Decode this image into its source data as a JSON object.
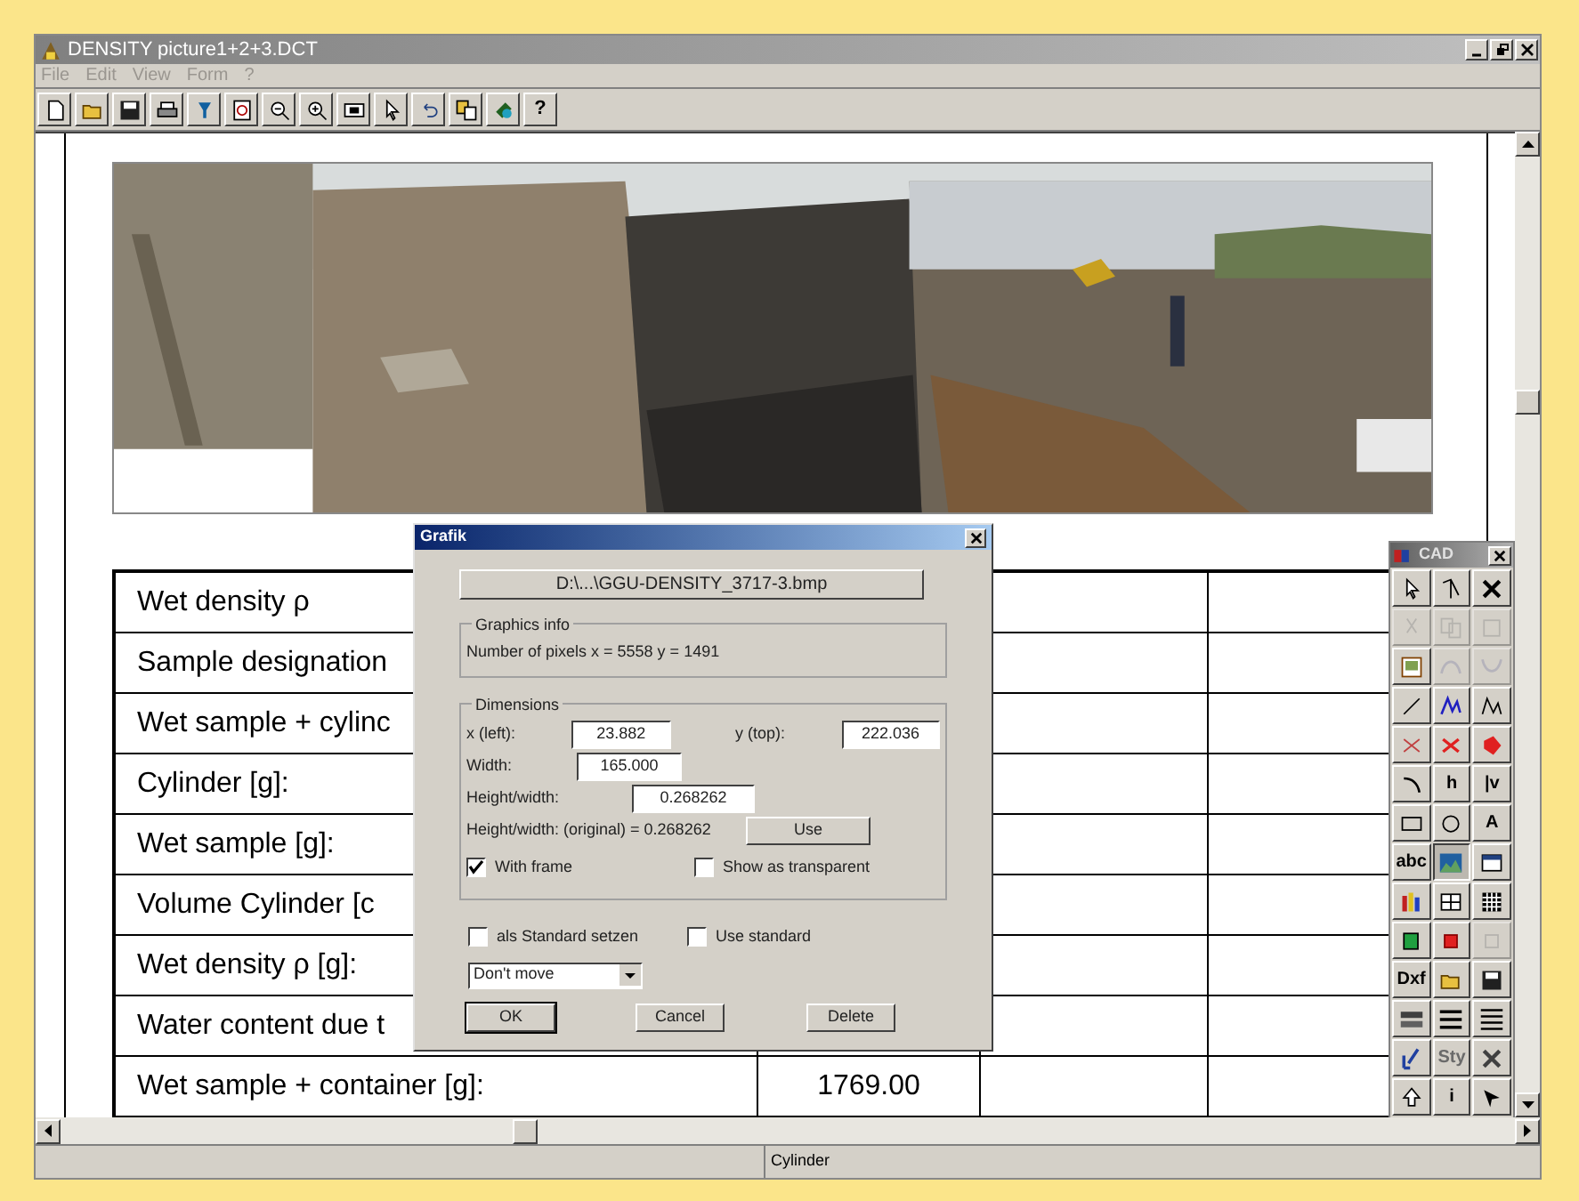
{
  "window": {
    "title": "DENSITY picture1+2+3.DCT"
  },
  "menu": [
    "File",
    "Edit",
    "View",
    "Form",
    "?"
  ],
  "toolbar": [
    {
      "kind": "icon"
    },
    {
      "kind": "icon"
    },
    {
      "kind": "icon"
    },
    {
      "kind": "icon"
    },
    {
      "kind": "icon"
    },
    {
      "kind": "icon"
    },
    {
      "kind": "icon"
    },
    {
      "kind": "icon"
    },
    {
      "kind": "icon"
    },
    {
      "kind": "icon"
    },
    {
      "kind": "icon"
    },
    {
      "kind": "icon"
    },
    {
      "kind": "icon"
    },
    {
      "kind": "text",
      "label": "?"
    }
  ],
  "table": {
    "rows": [
      {
        "label": "Wet density ρ"
      },
      {
        "label": "Sample designation"
      },
      {
        "label": "Wet sample + cylinc"
      },
      {
        "label": "Cylinder [g]:"
      },
      {
        "label": "Wet sample [g]:"
      },
      {
        "label": "Volume Cylinder [c"
      },
      {
        "label": "Wet density ρ [g]:"
      },
      {
        "label": "Water content due t"
      },
      {
        "label": "Wet sample + container [g]:",
        "value": "1769.00"
      }
    ]
  },
  "dialog": {
    "title": "Grafik",
    "file_button": "D:\\...\\GGU-DENSITY_3717-3.bmp",
    "info_group": "Graphics info",
    "info_text": "Number of pixels x = 5558  y = 1491",
    "dimensions_group": "Dimensions",
    "x_label": "x (left):",
    "x_value": "23.882",
    "y_label": "y (top):",
    "y_value": "222.036",
    "width_label": "Width:",
    "width_value": "165.000",
    "ratio_label": "Height/width:",
    "ratio_value": "0.268262",
    "original_text": "Height/width: (original) = 0.268262",
    "use_button": "Use",
    "checkboxes": [
      {
        "label": "With frame",
        "checked": true
      },
      {
        "label": "Show as transparent",
        "checked": false
      }
    ],
    "standard_checkboxes": [
      {
        "label": "als Standard setzen",
        "checked": false
      },
      {
        "label": "Use standard",
        "checked": false
      }
    ],
    "dropdown": "Don't move",
    "buttons": [
      {
        "label": "OK",
        "default": true
      },
      {
        "label": "Cancel",
        "default": false
      },
      {
        "label": "Delete",
        "default": false
      }
    ]
  },
  "palette": {
    "title": "CAD",
    "buttons": [
      {
        "kind": "icon",
        "disabled": false,
        "pressed": false
      },
      {
        "kind": "icon",
        "disabled": false,
        "pressed": false
      },
      {
        "kind": "icon",
        "disabled": false,
        "pressed": false
      },
      {
        "kind": "icon",
        "disabled": true,
        "pressed": false
      },
      {
        "kind": "icon",
        "disabled": true,
        "pressed": false
      },
      {
        "kind": "icon",
        "disabled": true,
        "pressed": false
      },
      {
        "kind": "icon",
        "disabled": false,
        "pressed": false
      },
      {
        "kind": "icon",
        "disabled": true,
        "pressed": false
      },
      {
        "kind": "icon",
        "disabled": true,
        "pressed": false
      },
      {
        "kind": "icon",
        "disabled": false,
        "pressed": false
      },
      {
        "kind": "icon",
        "disabled": false,
        "pressed": false
      },
      {
        "kind": "icon",
        "disabled": false,
        "pressed": false
      },
      {
        "kind": "icon",
        "disabled": false,
        "pressed": false
      },
      {
        "kind": "icon",
        "disabled": false,
        "pressed": false
      },
      {
        "kind": "icon",
        "disabled": false,
        "pressed": false
      },
      {
        "kind": "icon",
        "disabled": false,
        "pressed": false
      },
      {
        "kind": "text",
        "label": "h",
        "disabled": false,
        "pressed": false
      },
      {
        "kind": "text",
        "label": "|v",
        "disabled": false,
        "pressed": false
      },
      {
        "kind": "icon",
        "disabled": false,
        "pressed": false
      },
      {
        "kind": "icon",
        "disabled": false,
        "pressed": false
      },
      {
        "kind": "text",
        "label": "A",
        "disabled": false,
        "pressed": false
      },
      {
        "kind": "text",
        "label": "abc",
        "disabled": false,
        "pressed": false
      },
      {
        "kind": "icon",
        "disabled": false,
        "pressed": true
      },
      {
        "kind": "icon",
        "disabled": false,
        "pressed": false
      },
      {
        "kind": "icon",
        "disabled": false,
        "pressed": false
      },
      {
        "kind": "icon",
        "disabled": false,
        "pressed": false
      },
      {
        "kind": "icon",
        "disabled": false,
        "pressed": false
      },
      {
        "kind": "icon",
        "disabled": false,
        "pressed": false
      },
      {
        "kind": "icon",
        "disabled": false,
        "pressed": false
      },
      {
        "kind": "icon",
        "disabled": true,
        "pressed": false
      },
      {
        "kind": "text",
        "label": "Dxf",
        "disabled": false,
        "pressed": false
      },
      {
        "kind": "icon",
        "disabled": false,
        "pressed": false
      },
      {
        "kind": "icon",
        "disabled": false,
        "pressed": false
      },
      {
        "kind": "icon",
        "disabled": false,
        "pressed": false
      },
      {
        "kind": "icon",
        "disabled": false,
        "pressed": false
      },
      {
        "kind": "icon",
        "disabled": false,
        "pressed": false
      },
      {
        "kind": "icon",
        "disabled": false,
        "pressed": false
      },
      {
        "kind": "text",
        "label": "Sty",
        "disabled": true,
        "pressed": false
      },
      {
        "kind": "icon",
        "disabled": false,
        "pressed": false
      },
      {
        "kind": "icon",
        "disabled": false,
        "pressed": false
      },
      {
        "kind": "text",
        "label": "i",
        "disabled": false,
        "pressed": false
      },
      {
        "kind": "icon",
        "disabled": false,
        "pressed": false
      }
    ]
  },
  "status_bar": "Cylinder"
}
